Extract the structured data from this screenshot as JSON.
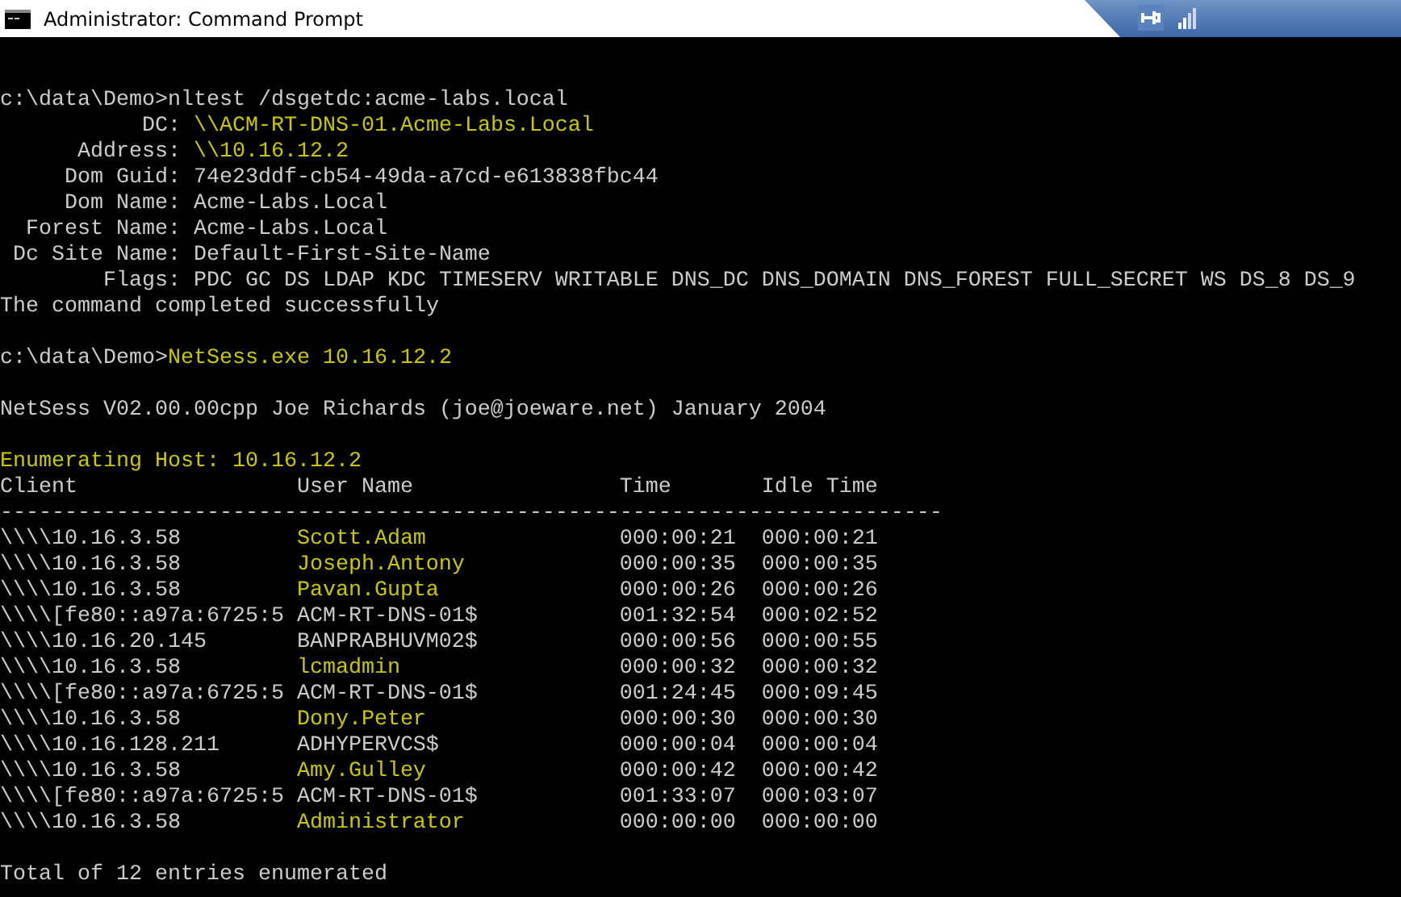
{
  "window": {
    "title": "Administrator: Command Prompt"
  },
  "console": {
    "lines": [
      {
        "kind": "blank"
      },
      {
        "kind": "text",
        "segments": [
          {
            "text": "c:\\data\\Demo>",
            "highlighted": false
          },
          {
            "text": "nltest /dsgetdc:acme-labs.local",
            "highlighted": false
          }
        ]
      },
      {
        "kind": "text",
        "segments": [
          {
            "text": "           DC: ",
            "highlighted": false
          },
          {
            "text": "\\\\ACM-RT-DNS-01.Acme-Labs.Local",
            "highlighted": true
          }
        ]
      },
      {
        "kind": "text",
        "segments": [
          {
            "text": "      Address: ",
            "highlighted": false
          },
          {
            "text": "\\\\10.16.12.2",
            "highlighted": true
          }
        ]
      },
      {
        "kind": "text",
        "segments": [
          {
            "text": "     Dom Guid: 74e23ddf-cb54-49da-a7cd-e613838fbc44",
            "highlighted": false
          }
        ]
      },
      {
        "kind": "text",
        "segments": [
          {
            "text": "     Dom Name: Acme-Labs.Local",
            "highlighted": false
          }
        ]
      },
      {
        "kind": "text",
        "segments": [
          {
            "text": "  Forest Name: Acme-Labs.Local",
            "highlighted": false
          }
        ]
      },
      {
        "kind": "text",
        "segments": [
          {
            "text": " Dc Site Name: Default-First-Site-Name",
            "highlighted": false
          }
        ]
      },
      {
        "kind": "text",
        "segments": [
          {
            "text": "        Flags: PDC GC DS LDAP KDC TIMESERV WRITABLE DNS_DC DNS_DOMAIN DNS_FOREST FULL_SECRET WS DS_8 DS_9",
            "highlighted": false
          }
        ]
      },
      {
        "kind": "text",
        "segments": [
          {
            "text": "The command completed successfully",
            "highlighted": false
          }
        ]
      },
      {
        "kind": "blank"
      },
      {
        "kind": "text",
        "segments": [
          {
            "text": "c:\\data\\Demo>",
            "highlighted": false
          },
          {
            "text": "NetSess.exe 10.16.12.2",
            "highlighted": true
          }
        ]
      },
      {
        "kind": "blank"
      },
      {
        "kind": "text",
        "segments": [
          {
            "text": "NetSess V02.00.00cpp Joe Richards (joe@joeware.net) January 2004",
            "highlighted": false
          }
        ]
      },
      {
        "kind": "blank"
      },
      {
        "kind": "text",
        "segments": [
          {
            "text": "Enumerating Host: 10.16.12.2",
            "highlighted": true
          }
        ]
      },
      {
        "kind": "table"
      },
      {
        "kind": "blank"
      },
      {
        "kind": "text",
        "segments": [
          {
            "text": "Total of 12 entries enumerated",
            "highlighted": false
          }
        ]
      }
    ]
  },
  "table": {
    "columns": [
      "Client",
      "User Name",
      "Time",
      "Idle Time"
    ],
    "divider": "-------------------------------------------------------------------------",
    "rows": [
      {
        "client": "\\\\\\\\10.16.3.58",
        "user": "Scott.Adam",
        "highlighted": true,
        "time": "000:00:21",
        "idle_time": "000:00:21"
      },
      {
        "client": "\\\\\\\\10.16.3.58",
        "user": "Joseph.Antony",
        "highlighted": true,
        "time": "000:00:35",
        "idle_time": "000:00:35"
      },
      {
        "client": "\\\\\\\\10.16.3.58",
        "user": "Pavan.Gupta",
        "highlighted": true,
        "time": "000:00:26",
        "idle_time": "000:00:26"
      },
      {
        "client": "\\\\\\\\[fe80::a97a:6725:5",
        "user": "ACM-RT-DNS-01$",
        "highlighted": false,
        "time": "001:32:54",
        "idle_time": "000:02:52"
      },
      {
        "client": "\\\\\\\\10.16.20.145",
        "user": "BANPRABHUVM02$",
        "highlighted": false,
        "time": "000:00:56",
        "idle_time": "000:00:55"
      },
      {
        "client": "\\\\\\\\10.16.3.58",
        "user": "lcmadmin",
        "highlighted": true,
        "time": "000:00:32",
        "idle_time": "000:00:32"
      },
      {
        "client": "\\\\\\\\[fe80::a97a:6725:5",
        "user": "ACM-RT-DNS-01$",
        "highlighted": false,
        "time": "001:24:45",
        "idle_time": "000:09:45"
      },
      {
        "client": "\\\\\\\\10.16.3.58",
        "user": "Dony.Peter",
        "highlighted": true,
        "time": "000:00:30",
        "idle_time": "000:00:30"
      },
      {
        "client": "\\\\\\\\10.16.128.211",
        "user": "ADHYPERVCS$",
        "highlighted": false,
        "time": "000:00:04",
        "idle_time": "000:00:04"
      },
      {
        "client": "\\\\\\\\10.16.3.58",
        "user": "Amy.Gulley",
        "highlighted": true,
        "time": "000:00:42",
        "idle_time": "000:00:42"
      },
      {
        "client": "\\\\\\\\[fe80::a97a:6725:5",
        "user": "ACM-RT-DNS-01$",
        "highlighted": false,
        "time": "001:33:07",
        "idle_time": "000:03:07"
      },
      {
        "client": "\\\\\\\\10.16.3.58",
        "user": "Administrator",
        "highlighted": true,
        "time": "000:00:00",
        "idle_time": "000:00:00"
      }
    ]
  }
}
